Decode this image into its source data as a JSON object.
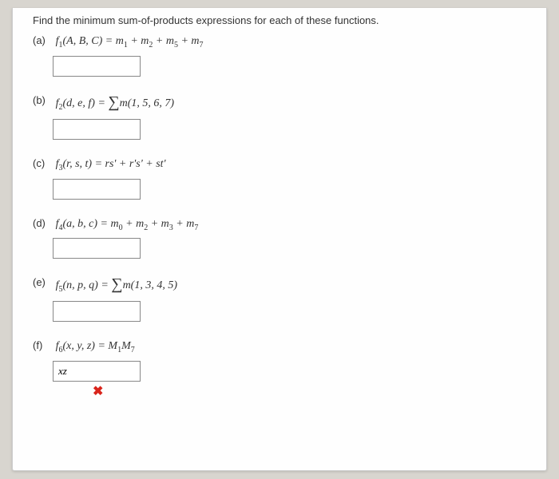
{
  "prompt": "Find the minimum sum-of-products expressions for each of these functions.",
  "questions": {
    "a": {
      "label": "(a)",
      "func": "f",
      "funcSub": "1",
      "vars": "(A, B, C) = m",
      "terms": " + m",
      "s1": "1",
      "s2": "2",
      "s3": "5",
      "s4": "7"
    },
    "b": {
      "label": "(b)",
      "func": "f",
      "funcSub": "2",
      "vars": "(d, e, f) = ",
      "minterms": "m(1, 5, 6, 7)"
    },
    "c": {
      "label": "(c)",
      "func": "f",
      "funcSub": "3",
      "expr": "(r, s, t) = rs' + r's' + st'"
    },
    "d": {
      "label": "(d)",
      "func": "f",
      "funcSub": "4",
      "vars": "(a, b, c) = m",
      "terms": " + m",
      "s1": "0",
      "s2": "2",
      "s3": "3",
      "s4": "7"
    },
    "e": {
      "label": "(e)",
      "func": "f",
      "funcSub": "5",
      "vars": "(n, p, q) = ",
      "minterms": "m(1, 3, 4, 5)"
    },
    "f": {
      "label": "(f)",
      "func": "f",
      "funcSub": "6",
      "vars": "(x, y, z) = M",
      "s1": "1",
      "terms": "M",
      "s2": "7",
      "answer": "xz"
    }
  },
  "markWrong": "✖"
}
